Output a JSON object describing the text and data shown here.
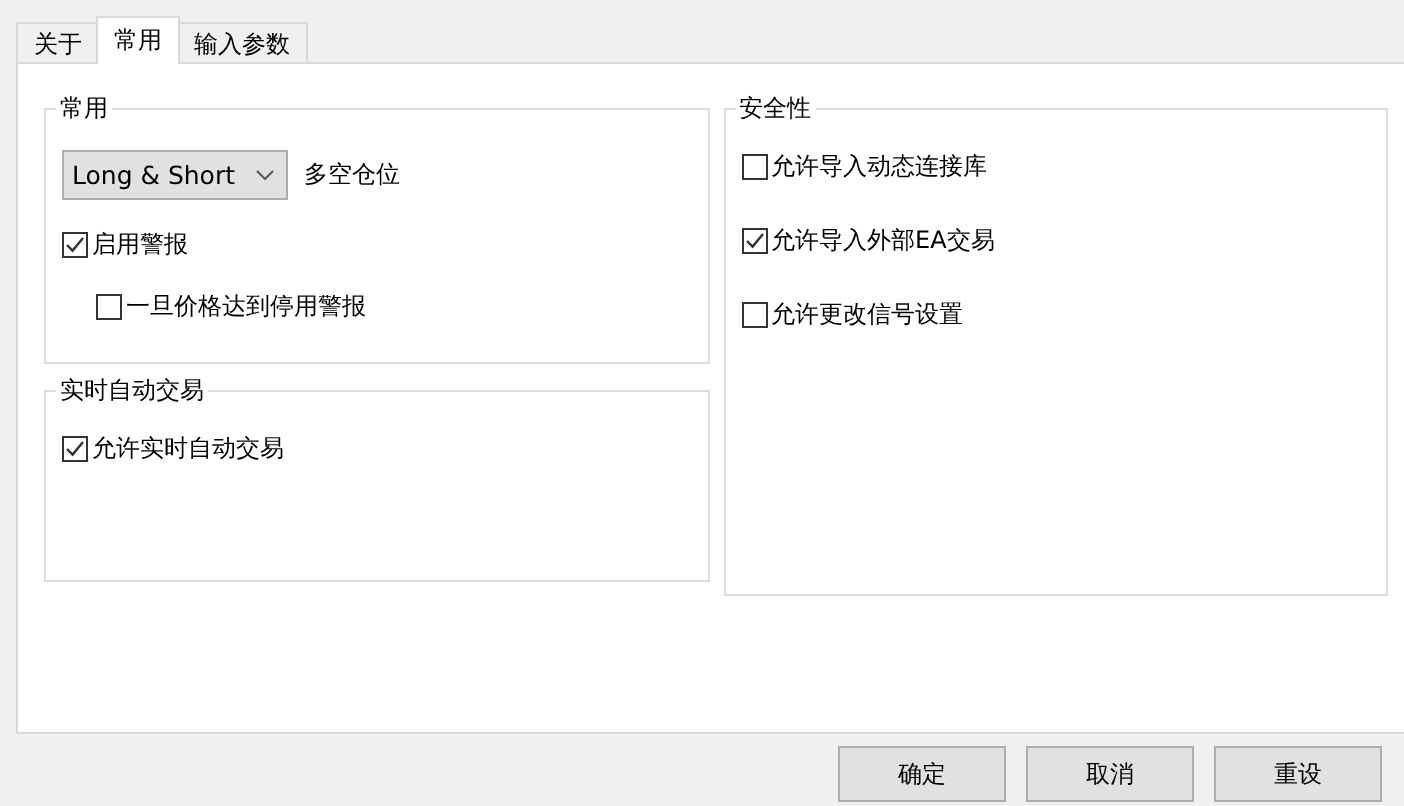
{
  "tabs": [
    {
      "label": "关于",
      "selected": false
    },
    {
      "label": "常用",
      "selected": true
    },
    {
      "label": "输入参数",
      "selected": false
    }
  ],
  "left_column": [
    {
      "title": "常用",
      "items": [
        {
          "kind": "dropdown",
          "value": "Long & Short",
          "label": "多空仓位"
        },
        {
          "kind": "checkbox",
          "label": "启用警报",
          "checked": true,
          "children": [
            {
              "kind": "checkbox",
              "label": "一旦价格达到停用警报",
              "checked": false
            }
          ]
        }
      ]
    },
    {
      "title": "实时自动交易",
      "items": [
        {
          "kind": "checkbox",
          "label": "允许实时自动交易",
          "checked": true
        }
      ]
    }
  ],
  "right_column": [
    {
      "title": "安全性",
      "items": [
        {
          "kind": "checkbox",
          "label": "允许导入动态连接库",
          "checked": false
        },
        {
          "kind": "checkbox",
          "label": "允许导入外部EA交易",
          "checked": true
        },
        {
          "kind": "checkbox",
          "label": "允许更改信号设置",
          "checked": false
        }
      ]
    }
  ],
  "buttons": [
    "确定",
    "取消",
    "重设"
  ]
}
